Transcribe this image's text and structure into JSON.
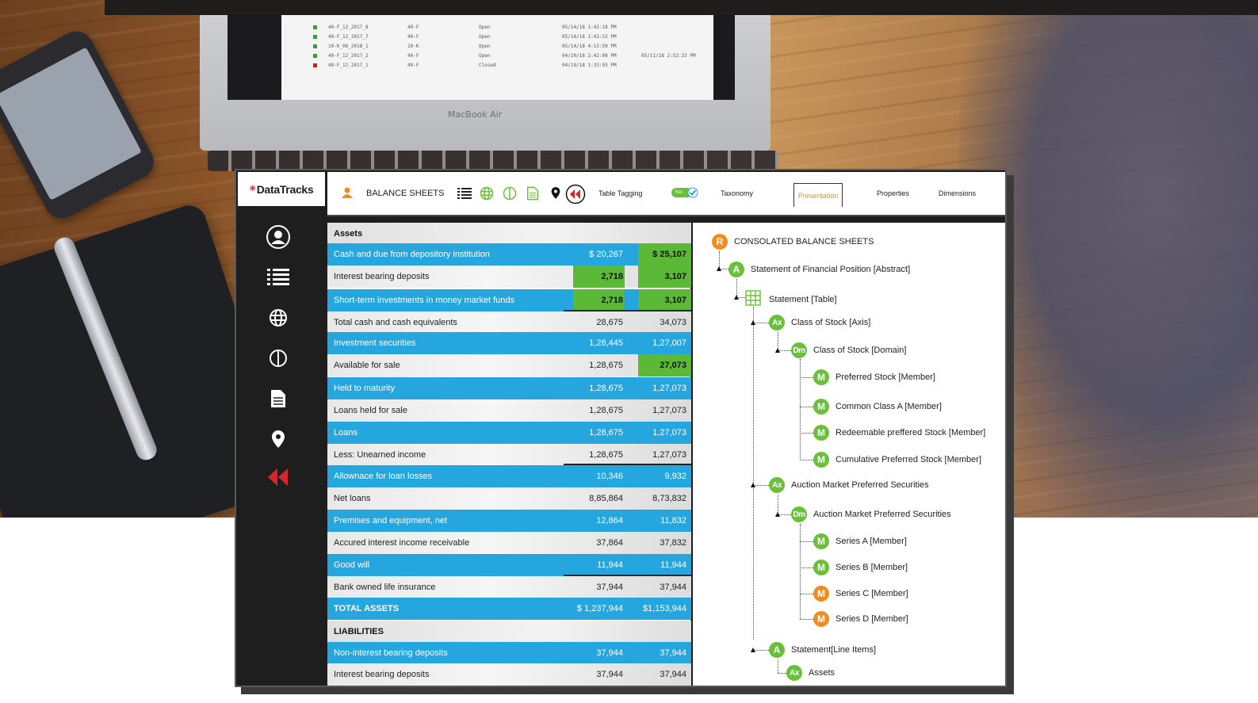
{
  "background": {
    "laptop_brand": "MacBook Air",
    "screen_rows": [
      {
        "name": "40-F_12_2017_8",
        "type": "40-F",
        "status": "Open",
        "date": "05/14/18 1:42:18 PM",
        "closed": "",
        "color": "#3a9b3a"
      },
      {
        "name": "40-F_12_2017_7",
        "type": "40-F",
        "status": "Open",
        "date": "05/14/18 1:41:53 PM",
        "closed": "",
        "color": "#3a9b3a"
      },
      {
        "name": "10-K_06_2018_1",
        "type": "10-K",
        "status": "Open",
        "date": "05/14/18 4:15:59 PM",
        "closed": "",
        "color": "#3a9b3a"
      },
      {
        "name": "40-F_12_2017_2",
        "type": "40-F",
        "status": "Open",
        "date": "04/20/18 2:42:08 PM",
        "closed": "05/11/18 2:52:23 PM",
        "color": "#3a9b3a"
      },
      {
        "name": "40-F_12_2017_1",
        "type": "40-F",
        "status": "Closed",
        "date": "04/19/18 1:33:03 PM",
        "closed": "",
        "color": "#d02020"
      }
    ]
  },
  "logo": {
    "brand": "DataTracks"
  },
  "sidebar": {
    "items": [
      {
        "name": "user-icon"
      },
      {
        "name": "list-icon"
      },
      {
        "name": "globe-icon"
      },
      {
        "name": "split-circle-icon"
      },
      {
        "name": "document-icon"
      },
      {
        "name": "location-pin-icon"
      },
      {
        "name": "collapse-arrows-icon"
      }
    ]
  },
  "toolbar": {
    "title": "BALANCE SHEETS",
    "table_tagging_label": "Table Tagging",
    "toggle_value": "Yes",
    "tabs": [
      {
        "label": "Taxonomy",
        "active": false
      },
      {
        "label": "Presentation",
        "active": true
      },
      {
        "label": "Properties",
        "active": false
      },
      {
        "label": "Dimensions",
        "active": false
      }
    ],
    "colors": {
      "accent": "#f28c1e",
      "green": "#6bbf3b",
      "blue": "#25a6df"
    }
  },
  "balance_sheet": {
    "assets_header": "Assets",
    "rows": [
      {
        "label": "Cash and due from depository institution",
        "v1": "$  20,267",
        "v2": "$  25,107",
        "style": "blue",
        "green_v2": true
      },
      {
        "label": "Interest bearing deposits",
        "v1": "2,718",
        "v2": "3,107",
        "style": "grey",
        "green_v1": true,
        "green_v2": true
      },
      {
        "label": "Short-term investments in money market funds",
        "v1": "2,718",
        "v2": "3,107",
        "style": "blue",
        "green_v1": true,
        "green_v2": true
      },
      {
        "label": "Total cash and cash equivalents",
        "v1": "28,675",
        "v2": "34,073",
        "style": "grey"
      },
      {
        "label": "Investment securities",
        "v1": "1,28,445",
        "v2": "1,27,007",
        "style": "blue"
      },
      {
        "label": "Available for sale",
        "v1": "1,28,675",
        "v2": "27,073",
        "style": "grey",
        "green_v2": true
      },
      {
        "label": "Held to maturity",
        "v1": "1,28,675",
        "v2": "1,27,073",
        "style": "blue"
      },
      {
        "label": "Loans held for sale",
        "v1": "1,28,675",
        "v2": "1,27,073",
        "style": "grey"
      },
      {
        "label": "Loans",
        "v1": "1,28,675",
        "v2": "1,27,073",
        "style": "blue"
      },
      {
        "label": "Less: Unearned income",
        "v1": "1,28,675",
        "v2": "1,27,073",
        "style": "grey"
      },
      {
        "label": "Allownace for loan losses",
        "v1": "10,346",
        "v2": "9,932",
        "style": "blue"
      },
      {
        "label": "Net loans",
        "v1": "8,85,864",
        "v2": "8,73,832",
        "style": "grey"
      },
      {
        "label": "Premises and equipment, net",
        "v1": "12,864",
        "v2": "11,832",
        "style": "blue"
      },
      {
        "label": "Accured interest income receivable",
        "v1": "37,864",
        "v2": "37,832",
        "style": "grey"
      },
      {
        "label": "Good will",
        "v1": "11,944",
        "v2": "11,944",
        "style": "blue"
      },
      {
        "label": "Bank owned life insurance",
        "v1": "37,944",
        "v2": "37,944",
        "style": "grey"
      },
      {
        "label": "TOTAL ASSETS",
        "v1": "$ 1,237,944",
        "v2": "$1,153,944",
        "style": "blue",
        "bold": true
      }
    ],
    "liabilities_header": "LIABILITIES",
    "liability_rows": [
      {
        "label": "Non-interest bearing deposits",
        "v1": "37,944",
        "v2": "37,944",
        "style": "blue"
      },
      {
        "label": "Interest bearing deposits",
        "v1": "37,944",
        "v2": "37,944",
        "style": "grey"
      }
    ]
  },
  "tree": {
    "root": {
      "badge": "R",
      "label": "CONSOLATED BALANCE SHEETS"
    },
    "nodes": [
      {
        "badge": "A",
        "label": "Statement of Financial Position [Abstract]",
        "color": "green"
      },
      {
        "badge": "table",
        "label": "Statement [Table]",
        "color": "green"
      },
      {
        "badge": "Ax",
        "label": "Class of Stock [Axis]",
        "color": "green"
      },
      {
        "badge": "Dm",
        "label": "Class of Stock [Domain]",
        "color": "green"
      },
      {
        "badge": "M",
        "label": "Preferred  Stock  [Member]",
        "color": "green"
      },
      {
        "badge": "M",
        "label": "Common Class A  [Member]",
        "color": "green"
      },
      {
        "badge": "M",
        "label": "Redeemable preffered Stock [Member]",
        "color": "green"
      },
      {
        "badge": "M",
        "label": "Cumulative Preferred Stock [Member]",
        "color": "green"
      },
      {
        "badge": "Ax",
        "label": "Auction Market Preferred Securities",
        "color": "green"
      },
      {
        "badge": "Dm",
        "label": "Auction Market Preferred Securities",
        "color": "green"
      },
      {
        "badge": "M",
        "label": "Series A [Member]",
        "color": "green"
      },
      {
        "badge": "M",
        "label": "Series B [Member]",
        "color": "green"
      },
      {
        "badge": "M",
        "label": "Series C [Member]",
        "color": "orange"
      },
      {
        "badge": "M",
        "label": "Series D [Member]",
        "color": "orange"
      },
      {
        "badge": "A",
        "label": "Statement[Line Items]",
        "color": "green"
      },
      {
        "badge": "Ax",
        "label": "Assets",
        "color": "green"
      }
    ]
  }
}
